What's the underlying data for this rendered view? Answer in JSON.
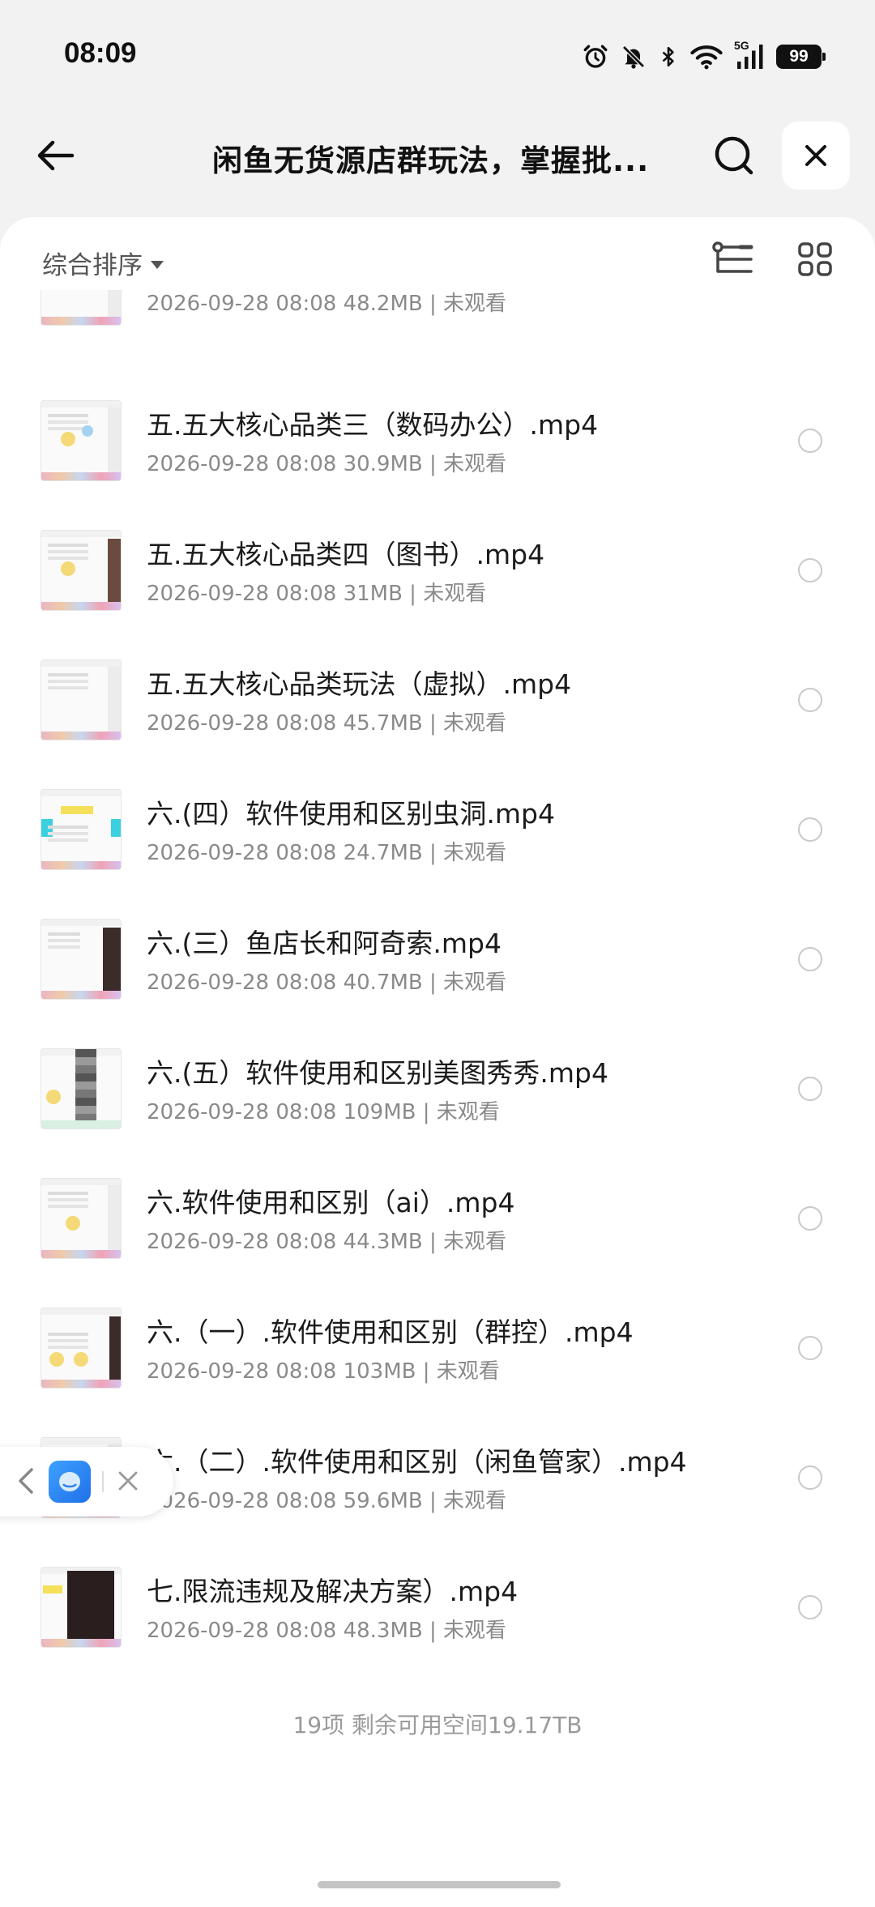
{
  "status_bar": {
    "time": "08:09",
    "network": "5G",
    "battery": "99",
    "icons": [
      "alarm-icon",
      "mute-icon",
      "bluetooth-icon",
      "wifi-icon",
      "signal-icon",
      "battery-icon"
    ]
  },
  "title_bar": {
    "title": "闲鱼无货源店群玩法，掌握批...",
    "back_icon": "back-arrow-icon",
    "search_icon": "search-icon",
    "close_icon": "close-icon"
  },
  "toolbar": {
    "sort_label": "综合排序",
    "tree_view_icon": "tree-view-icon",
    "grid_view_icon": "grid-view-icon"
  },
  "files": [
    {
      "name": "",
      "date": "2026-09-28 08:08",
      "size": "48.2MB",
      "status": "未观看"
    },
    {
      "name": "五.五大核心品类三（数码办公）.mp4",
      "date": "2026-09-28 08:08",
      "size": "30.9MB",
      "status": "未观看"
    },
    {
      "name": "五.五大核心品类四（图书）.mp4",
      "date": "2026-09-28 08:08",
      "size": "31MB",
      "status": "未观看"
    },
    {
      "name": "五.五大核心品类玩法（虚拟）.mp4",
      "date": "2026-09-28 08:08",
      "size": "45.7MB",
      "status": "未观看"
    },
    {
      "name": "六.(四）软件使用和区别虫洞.mp4",
      "date": "2026-09-28 08:08",
      "size": "24.7MB",
      "status": "未观看"
    },
    {
      "name": "六.(三）鱼店长和阿奇索.mp4",
      "date": "2026-09-28 08:08",
      "size": "40.7MB",
      "status": "未观看"
    },
    {
      "name": "六.(五）软件使用和区别美图秀秀.mp4",
      "date": "2026-09-28 08:08",
      "size": "109MB",
      "status": "未观看"
    },
    {
      "name": "六.软件使用和区别（ai）.mp4",
      "date": "2026-09-28 08:08",
      "size": "44.3MB",
      "status": "未观看"
    },
    {
      "name": "六.（一）.软件使用和区别（群控）.mp4",
      "date": "2026-09-28 08:08",
      "size": "103MB",
      "status": "未观看"
    },
    {
      "name": "六.（二）.软件使用和区别（闲鱼管家）.mp4",
      "date": "2026-09-28 08:08",
      "size": "59.6MB",
      "status": "未观看"
    },
    {
      "name": "七.限流违规及解决方案）.mp4",
      "date": "2026-09-28 08:08",
      "size": "48.3MB",
      "status": "未观看"
    }
  ],
  "footer": {
    "summary": "19项 剩余可用空间19.17TB"
  },
  "floating_pill": {
    "back_icon": "chevron-left-icon",
    "app_icon": "app-icon",
    "close_icon": "close-icon"
  }
}
